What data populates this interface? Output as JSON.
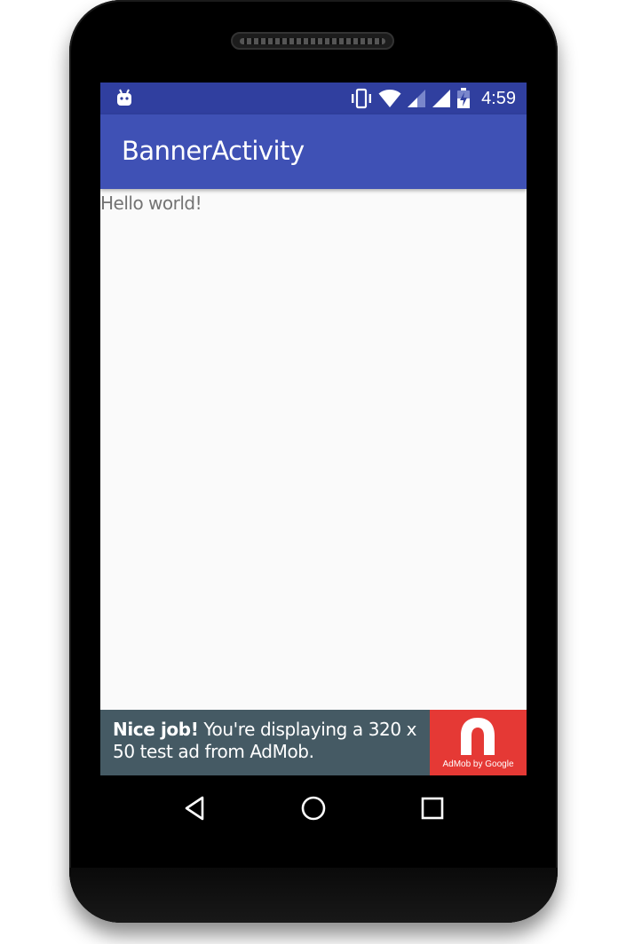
{
  "status_bar": {
    "time": "4:59",
    "icons": [
      "android-notification-icon",
      "vibrate-icon",
      "wifi-icon",
      "cell-signal-icon",
      "cell-signal-icon",
      "battery-charging-icon"
    ],
    "background_color": "#303f9f"
  },
  "app_bar": {
    "title": "BannerActivity",
    "background_color": "#3f51b5"
  },
  "content": {
    "text": "Hello world!"
  },
  "ad_banner": {
    "headline": "Nice job!",
    "message": "You're displaying a 320 x 50 test ad from AdMob.",
    "logo_caption": "AdMob by Google",
    "background_color": "#455a64",
    "logo_color": "#e53935"
  },
  "nav_bar": {
    "buttons": [
      "back-icon",
      "home-icon",
      "recents-icon"
    ]
  }
}
